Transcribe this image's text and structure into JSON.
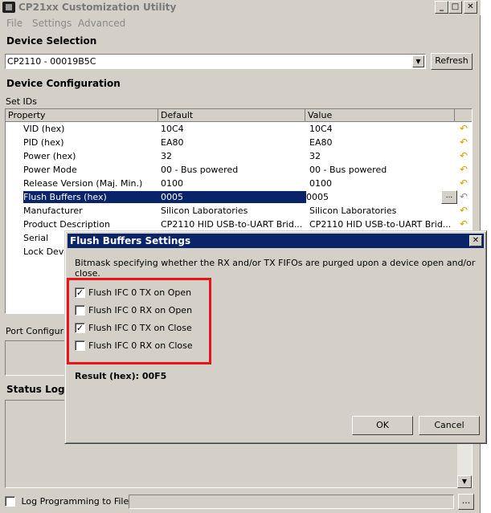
{
  "window": {
    "title": "CP21xx Customization Utility",
    "minimize": "_",
    "maximize": "□",
    "close": "✕"
  },
  "menu": [
    "File",
    "Settings",
    "Advanced"
  ],
  "device_selection": {
    "heading": "Device Selection",
    "selected_device": "CP2110 - 00019B5C",
    "refresh_label": "Refresh"
  },
  "device_configuration": {
    "heading": "Device Configuration",
    "group_label": "Set IDs",
    "columns": [
      "Property",
      "Default",
      "Value"
    ],
    "rows": [
      {
        "property": "VID (hex)",
        "default": "10C4",
        "value": "10C4"
      },
      {
        "property": "PID (hex)",
        "default": "EA80",
        "value": "EA80"
      },
      {
        "property": "Power (hex)",
        "default": "32",
        "value": "32"
      },
      {
        "property": "Power Mode",
        "default": "00 - Bus powered",
        "value": "00 - Bus powered"
      },
      {
        "property": "Release Version (Maj. Min.)",
        "default": "0100",
        "value": "0100"
      },
      {
        "property": "Flush Buffers (hex)",
        "default": "0005",
        "value": "0005"
      },
      {
        "property": "Manufacturer",
        "default": "Silicon Laboratories",
        "value": "Silicon Laboratories"
      },
      {
        "property": "Product Description",
        "default": "CP2110 HID USB-to-UART Brid...",
        "value": "CP2110 HID USB-to-UART Brid..."
      },
      {
        "property": "Serial",
        "default": "",
        "value": ""
      },
      {
        "property": "Lock Devi",
        "default": "",
        "value": ""
      }
    ],
    "ellipsis_label": "..."
  },
  "port_config": {
    "label": "Port Configura"
  },
  "status_log": {
    "heading": "Status Logg"
  },
  "log_programming": {
    "label": "Log Programming to File:",
    "browse_label": "..."
  },
  "dialog": {
    "title": "Flush Buffers Settings",
    "close": "✕",
    "description": "Bitmask specifying whether the RX and/or TX FIFOs are purged upon a device open and/or close.",
    "options": [
      {
        "label": "Flush IFC 0 TX on Open",
        "checked": true
      },
      {
        "label": "Flush IFC 0 RX on Open",
        "checked": false
      },
      {
        "label": "Flush IFC 0 TX on Close",
        "checked": true
      },
      {
        "label": "Flush IFC 0 RX on Close",
        "checked": false
      }
    ],
    "result": "Result (hex): 00F5",
    "ok_label": "OK",
    "cancel_label": "Cancel"
  },
  "colors": {
    "selection": "#0a246a",
    "highlight_box": "#e8141c",
    "undo_icon": "#c8a400"
  }
}
